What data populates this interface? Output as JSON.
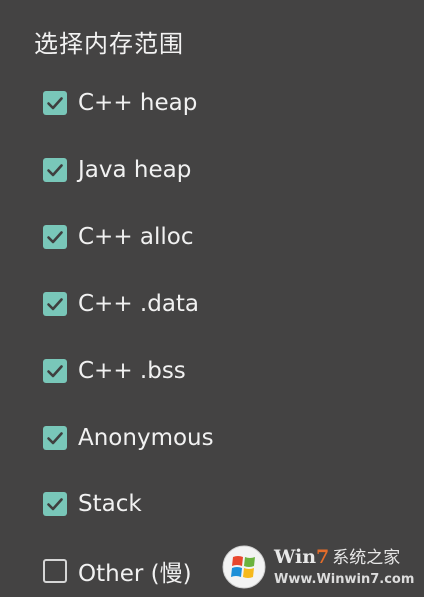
{
  "dialog": {
    "title": "选择内存范围",
    "items": [
      {
        "label": "C++ heap",
        "checked": true
      },
      {
        "label": "Java heap",
        "checked": true
      },
      {
        "label": "C++ alloc",
        "checked": true
      },
      {
        "label": "C++ .data",
        "checked": true
      },
      {
        "label": "C++ .bss",
        "checked": true
      },
      {
        "label": "Anonymous",
        "checked": true
      },
      {
        "label": "Stack",
        "checked": true
      },
      {
        "label": "Other (慢)",
        "checked": false
      }
    ]
  },
  "watermark": {
    "brand_prefix": "Win",
    "brand_seven": "7",
    "brand_cn": "系统之家",
    "url": "Www.Winwin7.com"
  },
  "colors": {
    "background": "#444343",
    "checkbox_checked": "#79c7b9",
    "text": "#f1f1f1"
  }
}
